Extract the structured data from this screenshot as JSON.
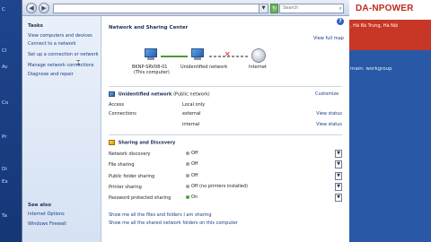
{
  "background": {
    "left_labels": [
      "C",
      "Cl",
      "Ac",
      "Co",
      "Pr",
      "Di",
      "Ex",
      "Ta"
    ],
    "brand": "DA-NPOWER",
    "address": ", Hà Bà Trưng, Hà Nội",
    "domain_text": "main: workgroup"
  },
  "toolbar": {
    "back_glyph": "◀",
    "forward_glyph": "▶",
    "address_dropdown_glyph": "▼",
    "refresh_glyph": "↻",
    "search_placeholder": "Search",
    "search_icon": "magnifier-icon"
  },
  "tasks": {
    "heading": "Tasks",
    "items": [
      "View computers and devices",
      "Connect to a network",
      "Set up a connection or network",
      "Manage network connections",
      "Diagnose and repair"
    ]
  },
  "see_also": {
    "heading": "See also",
    "items": [
      "Internet Options",
      "Windows Firewall"
    ]
  },
  "main": {
    "help_glyph": "?",
    "title": "Network and Sharing Center",
    "view_full_map": "View full map",
    "map": {
      "computer_name": "BKNP-SRV08-01",
      "computer_sub": "(This computer)",
      "network_label": "Unidentified network",
      "internet_label": "Internet"
    },
    "network": {
      "name": "Unidentified network",
      "type": "(Public network)",
      "customize": "Customize",
      "access_label": "Access",
      "access_value": "Local only",
      "connections_label": "Connections",
      "connections": [
        {
          "name": "external",
          "action": "View status"
        },
        {
          "name": "internal",
          "action": "View status"
        }
      ]
    },
    "sharing": {
      "heading": "Sharing and Discovery",
      "rows": [
        {
          "label": "Network discovery",
          "state": "Off",
          "color": "#9aa0a8"
        },
        {
          "label": "File sharing",
          "state": "Off",
          "color": "#9aa0a8"
        },
        {
          "label": "Public folder sharing",
          "state": "Off",
          "color": "#9aa0a8"
        },
        {
          "label": "Printer sharing",
          "state": "Off (no printers installed)",
          "color": "#9aa0a8"
        },
        {
          "label": "Password protected sharing",
          "state": "On",
          "color": "#3fae2a"
        }
      ],
      "expand_glyph": "▼"
    },
    "bottom_links": [
      "Show me all the files and folders I am sharing",
      "Show me all the shared network folders on this computer"
    ]
  }
}
